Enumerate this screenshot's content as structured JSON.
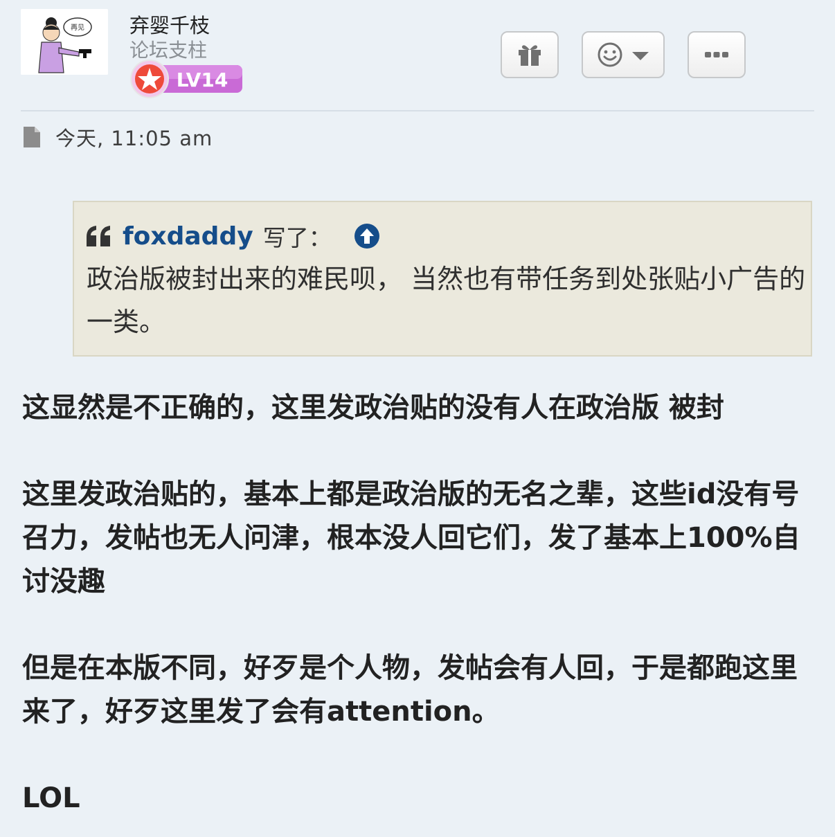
{
  "user": {
    "name": "弃婴千枝",
    "rank": "论坛支柱",
    "level": "LV14",
    "avatar_text": "再见"
  },
  "actions": {
    "gift_icon": "gift-icon",
    "emoji_icon": "smiley-icon",
    "dropdown_icon": "caret-down-icon",
    "more_icon": "ellipsis-icon"
  },
  "post": {
    "file_icon": "file-icon",
    "timestamp": "今天, 11:05 am",
    "quote": {
      "author": "foxdaddy",
      "wrote": "写了：",
      "text": "政治版被封出来的难民呗， 当然也有带任务到处张贴小广告的一类。"
    },
    "paragraphs": [
      "这显然是不正确的，这里发政治贴的没有人在政治版 被封",
      "这里发政治贴的，基本上都是政治版的无名之辈，这些id没有号召力，发帖也无人问津，根本没人回它们，发了基本上100%自讨没趣",
      "但是在本版不同，好歹是个人物，发帖会有人回，于是都跑这里来了，好歹这里发了会有attention。",
      "LOL"
    ]
  },
  "colors": {
    "background": "#ebf1f6",
    "quote_bg": "#ebe9dd",
    "link": "#154d8a",
    "badge": "#cc66dd"
  }
}
